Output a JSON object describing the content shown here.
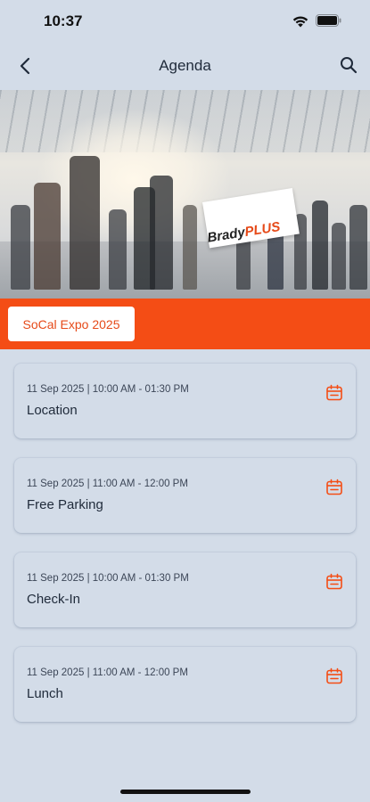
{
  "status_bar": {
    "time": "10:37"
  },
  "header": {
    "title": "Agenda"
  },
  "hero": {
    "sign_part1": "Brady",
    "sign_part2": "PLUS"
  },
  "event": {
    "chip_label": "SoCal Expo 2025"
  },
  "colors": {
    "accent": "#f44d15",
    "background": "#d3dce8"
  },
  "agenda": [
    {
      "datetime": "11 Sep 2025 | 10:00 AM - 01:30 PM",
      "title": "Location"
    },
    {
      "datetime": "11 Sep 2025 | 11:00 AM - 12:00 PM",
      "title": "Free Parking"
    },
    {
      "datetime": "11 Sep 2025 | 10:00 AM - 01:30 PM",
      "title": "Check-In"
    },
    {
      "datetime": "11 Sep 2025 | 11:00 AM - 12:00 PM",
      "title": "Lunch"
    }
  ]
}
